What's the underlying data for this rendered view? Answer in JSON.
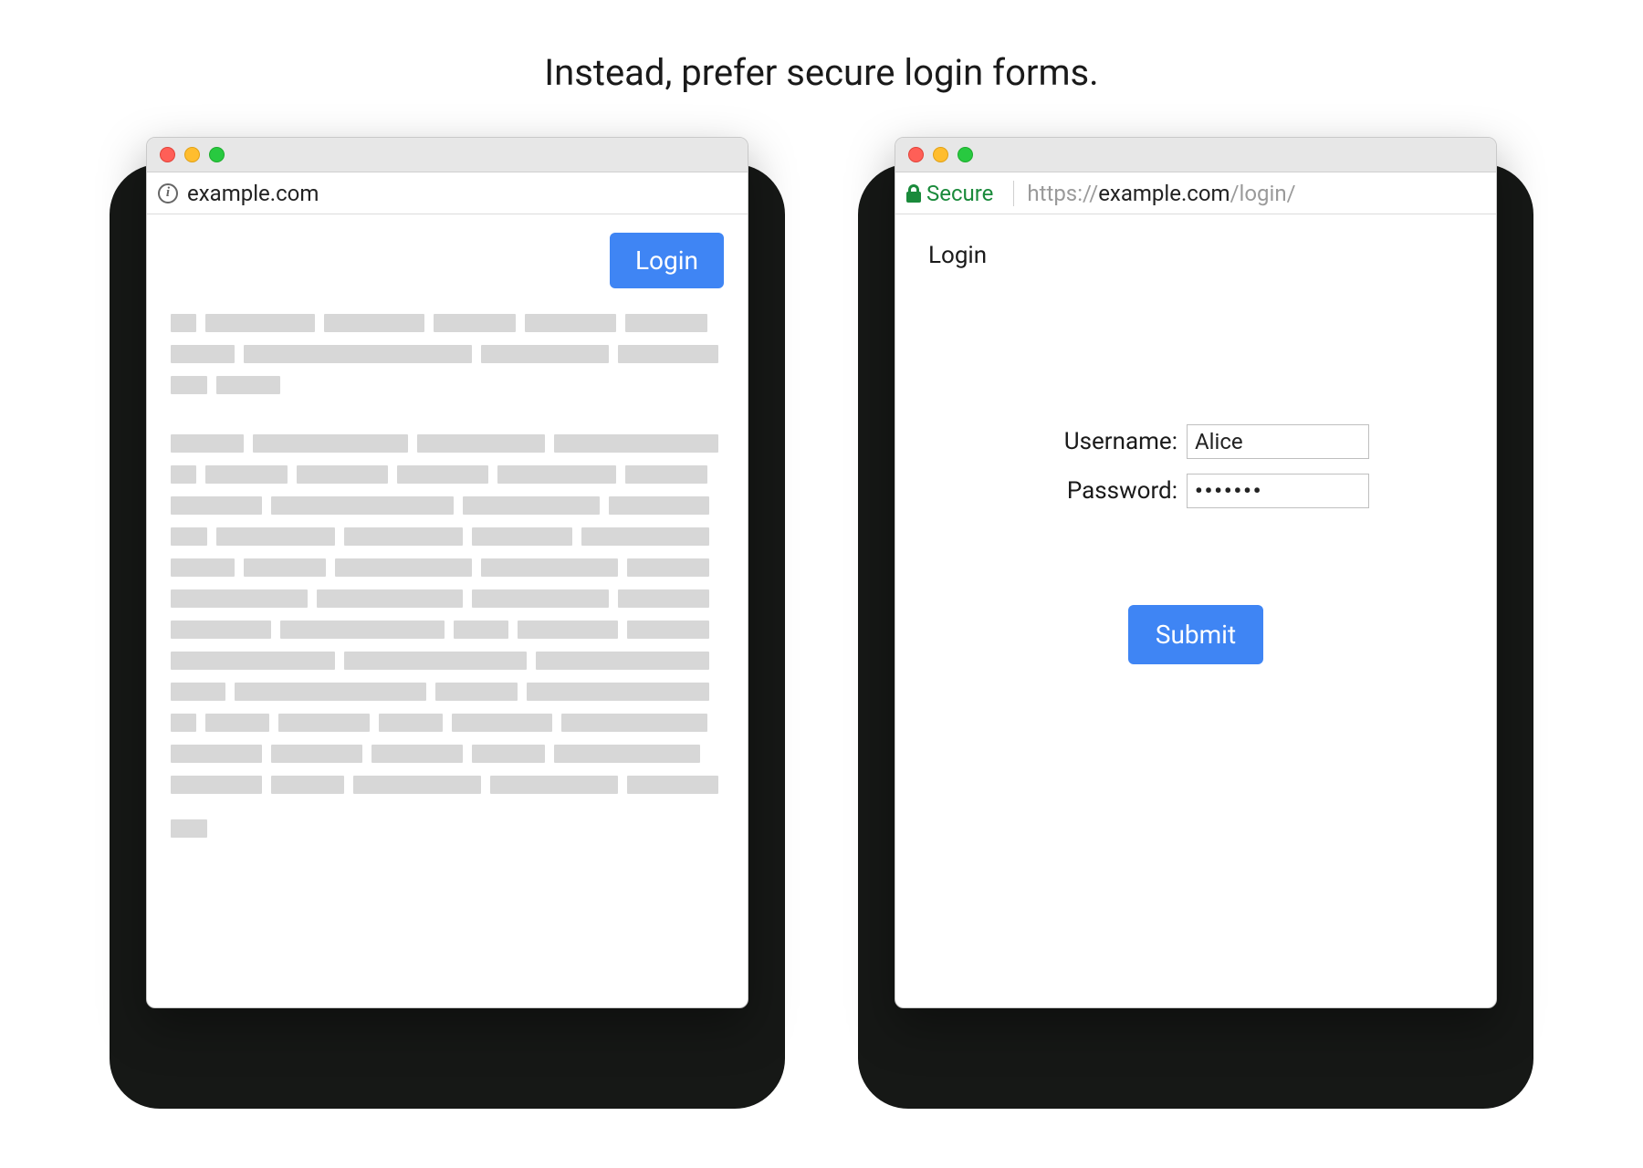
{
  "caption": "Instead, prefer secure login forms.",
  "left_window": {
    "addressbar": {
      "url": "example.com"
    },
    "login_button_label": "Login"
  },
  "right_window": {
    "addressbar": {
      "secure_label": "Secure",
      "url_scheme": "https://",
      "url_host": "example.com",
      "url_path": "/login/"
    },
    "page_heading": "Login",
    "form": {
      "username_label": "Username:",
      "username_value": "Alice",
      "password_label": "Password:",
      "password_value": "•••••••",
      "submit_label": "Submit"
    }
  }
}
